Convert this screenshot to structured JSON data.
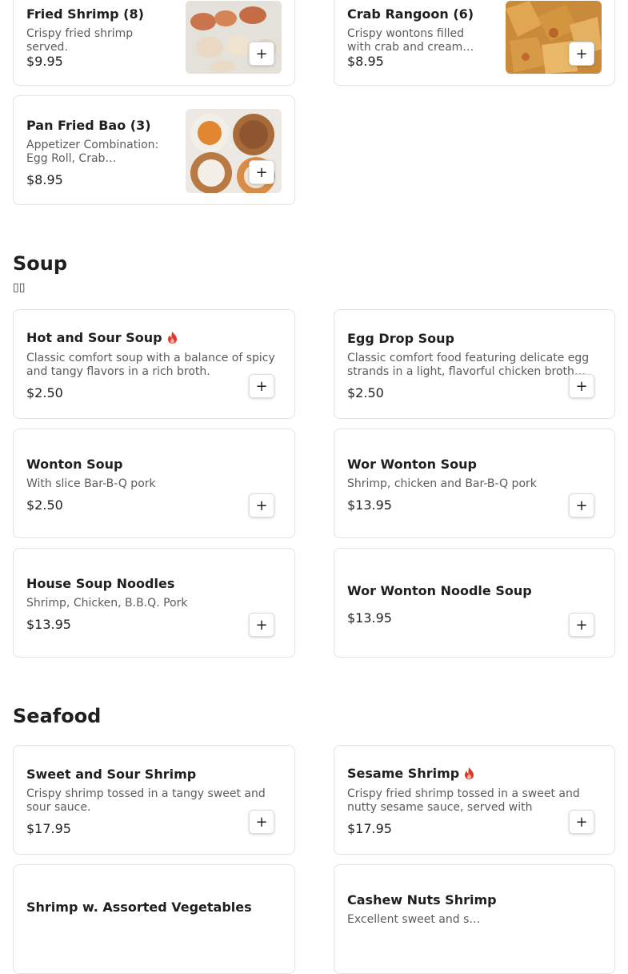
{
  "colors": {
    "spicy": "#d93a2b",
    "border": "#e3e3e3",
    "text": "#1f1f1f",
    "muted": "#5b5b5b"
  },
  "add_label": "+",
  "top_items": [
    {
      "name": "Fried Shrimp (8)",
      "desc": "Crispy fried shrimp served.",
      "price": "$9.95",
      "image": "fried-shrimp-photo"
    },
    {
      "name": "Crab Rangoon (6)",
      "desc": "Crispy wontons filled with crab and cream…",
      "price": "$8.95",
      "image": "crab-rangoon-photo"
    },
    {
      "name": "Pan Fried Bao (3)",
      "desc": "Appetizer Combination: Egg Roll, Crab…",
      "price": "$8.95",
      "image": "pan-fried-bao-photo"
    }
  ],
  "soup": {
    "title": "Soup",
    "subtitle": "▯▯",
    "items": [
      {
        "name": "Hot and Sour Soup",
        "spicy": true,
        "desc": "Classic comfort soup with a balance of spicy and tangy flavors in a rich broth.",
        "price": "$2.50"
      },
      {
        "name": "Egg Drop Soup",
        "desc": "Classic comfort food featuring delicate egg strands in a light, flavorful chicken broth…",
        "price": "$2.50"
      },
      {
        "name": "Wonton Soup",
        "desc": "With slice Bar-B-Q pork",
        "price": "$2.50"
      },
      {
        "name": "Wor Wonton Soup",
        "desc": "Shrimp, chicken and Bar-B-Q pork",
        "price": "$13.95"
      },
      {
        "name": "House Soup Noodles",
        "desc": "Shrimp, Chicken, B.B.Q. Pork",
        "price": "$13.95"
      },
      {
        "name": "Wor Wonton Noodle Soup",
        "desc": "",
        "price": "$13.95"
      }
    ]
  },
  "seafood": {
    "title": "Seafood",
    "items": [
      {
        "name": "Sweet and Sour Shrimp",
        "desc": "Crispy shrimp tossed in a tangy sweet and sour sauce.",
        "price": "$17.95"
      },
      {
        "name": "Sesame Shrimp",
        "spicy": true,
        "desc": "Crispy fried shrimp tossed in a sweet and nutty sesame sauce, served with steamed…",
        "price": "$17.95"
      },
      {
        "name": "Shrimp w. Assorted Vegetables",
        "desc": "",
        "price": ""
      },
      {
        "name": "Cashew Nuts Shrimp",
        "desc": "Excellent sweet and s…",
        "price": ""
      }
    ]
  }
}
